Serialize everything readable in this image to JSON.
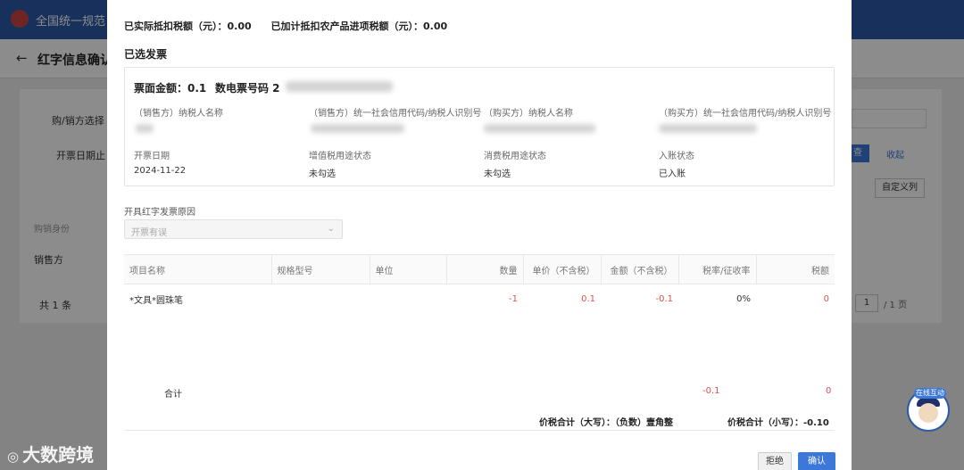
{
  "background": {
    "brand": "全国统一规范",
    "page_title": "红字信息确认",
    "filter_buyer_seller": "购/销方选择",
    "filter_issue_date": "开票日期止",
    "table_header_role": "购销身份",
    "row_role": "销售方",
    "total_count": "共 1 条",
    "query_button": "查",
    "collapse_label": "收起",
    "custom_columns": "自定义列",
    "page_number": "1",
    "page_total": "/ 1 页"
  },
  "modal": {
    "deduction_summary": [
      "已实际抵扣税额（元）：0.00",
      "已加计抵扣农产品进项税额（元）：0.00"
    ],
    "selected_section_title": "已选发票",
    "invoice": {
      "amount_label": "票面金额：0.1",
      "number_label": "数电票号码 2",
      "fields": [
        {
          "label": "（销售方）纳税人名称",
          "value": ""
        },
        {
          "label": "（销售方）统一社会信用代码/纳税人识别号",
          "value": ""
        },
        {
          "label": "（购买方）纳税人名称",
          "value": ""
        },
        {
          "label": "（购买方）统一社会信用代码/纳税人识别号",
          "value": ""
        },
        {
          "label": "开票日期",
          "value": "2024-11-22"
        },
        {
          "label": "增值税用途状态",
          "value": "未勾选"
        },
        {
          "label": "消费税用途状态",
          "value": "未勾选"
        },
        {
          "label": "入账状态",
          "value": "已入账"
        }
      ]
    },
    "reason": {
      "label": "开具红字发票原因",
      "placeholder": "开票有误"
    },
    "table": {
      "headers": [
        "项目名称",
        "规格型号",
        "单位",
        "数量",
        "单价（不含税）",
        "金额（不含税）",
        "税率/征收率",
        "税额"
      ],
      "rows": [
        {
          "name": "*文具*圆珠笔",
          "spec": "",
          "unit": "",
          "qty": "-1",
          "price": "0.1",
          "amount": "-0.1",
          "rate": "0%",
          "tax": "0"
        }
      ],
      "total_label": "合计",
      "total_amount": "-0.1",
      "total_tax": "0"
    },
    "price_tax_upper": "价税合计（大写）：（负数）壹角整",
    "price_tax_lower": "价税合计（小写）：-0.10",
    "reject_button": "拒绝",
    "confirm_button": "确认"
  },
  "watermark": "大数跨境",
  "mascot_tag": "在线互动",
  "colors": {
    "primary": "#3d78d8",
    "negative": "#d9534f",
    "header": "#2d5aa8"
  }
}
